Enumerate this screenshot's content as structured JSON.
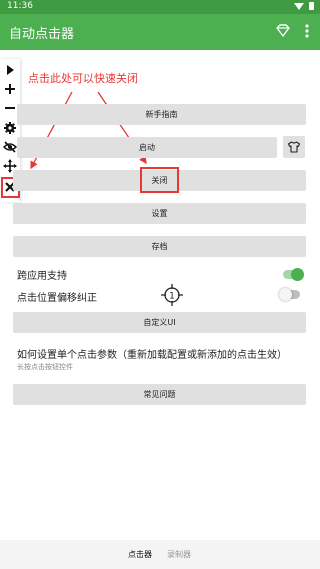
{
  "status_bar": {
    "time": "11:36"
  },
  "app_bar": {
    "title": "自动点击器",
    "icons": [
      "diamond-icon",
      "more-vert-icon"
    ]
  },
  "floating_toolbar": {
    "icons": [
      "play-icon",
      "add-icon",
      "remove-icon",
      "settings-icon",
      "visibility-off-icon",
      "move-icon",
      "close-icon"
    ]
  },
  "annotation": {
    "text": "点击此处可以快速关闭"
  },
  "buttons": {
    "guide": "新手指南",
    "start": "启动",
    "close": "关闭",
    "settings": "设置",
    "archive": "存档",
    "custom_ui": "自定义UI",
    "faq": "常见问题"
  },
  "toggles": {
    "cross_app": {
      "label": "跨应用支持",
      "on": true
    },
    "offset_fix": {
      "label": "点击位置偏移纠正",
      "on": false
    }
  },
  "help": {
    "question": "如何设置单个点击参数（重新加载配置或新添加的点击生效）",
    "hint": "长按点击按钮控件"
  },
  "bottom_nav": {
    "tabs": [
      "点击器",
      "录制器"
    ],
    "active": "点击器"
  },
  "colors": {
    "app_bar": "#4caf50",
    "status_bar": "#3f9a42",
    "accent_red": "#e53935",
    "button_gray": "#e0e0e0"
  }
}
